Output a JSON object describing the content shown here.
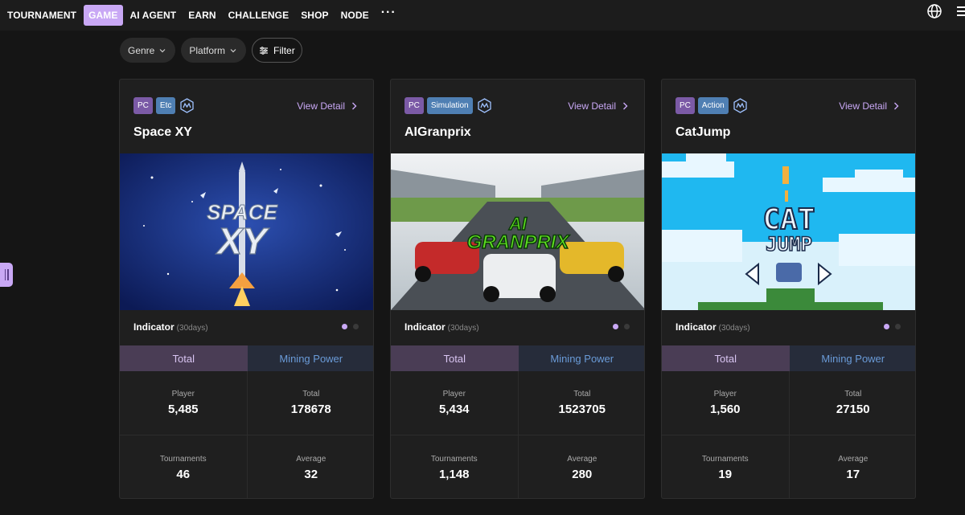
{
  "nav": {
    "items": [
      {
        "label": "TOURNAMENT",
        "active": false
      },
      {
        "label": "GAME",
        "active": true
      },
      {
        "label": "AI AGENT",
        "active": false
      },
      {
        "label": "EARN",
        "active": false
      },
      {
        "label": "CHALLENGE",
        "active": false
      },
      {
        "label": "SHOP",
        "active": false
      },
      {
        "label": "NODE",
        "active": false
      }
    ],
    "more": "···",
    "accent": "#c9a8f5"
  },
  "filters": {
    "genre": "Genre",
    "platform": "Platform",
    "filter": "Filter"
  },
  "cards": [
    {
      "platform": "PC",
      "genre": "Etc",
      "view_detail": "View Detail",
      "title": "Space XY",
      "art_line1": "SPACE",
      "art_line2": "XY",
      "indicator": "Indicator",
      "indicator_period": "(30days)",
      "tab_total": "Total",
      "tab_mining": "Mining Power",
      "stats": [
        {
          "label": "Player",
          "value": "5,485"
        },
        {
          "label": "Total",
          "value": "178678"
        },
        {
          "label": "Tournaments",
          "value": "46"
        },
        {
          "label": "Average",
          "value": "32"
        }
      ]
    },
    {
      "platform": "PC",
      "genre": "Simulation",
      "view_detail": "View Detail",
      "title": "AIGranprix",
      "art_line1": "AI",
      "art_line2": "GRANPRIX",
      "indicator": "Indicator",
      "indicator_period": "(30days)",
      "tab_total": "Total",
      "tab_mining": "Mining Power",
      "stats": [
        {
          "label": "Player",
          "value": "5,434"
        },
        {
          "label": "Total",
          "value": "1523705"
        },
        {
          "label": "Tournaments",
          "value": "1,148"
        },
        {
          "label": "Average",
          "value": "280"
        }
      ]
    },
    {
      "platform": "PC",
      "genre": "Action",
      "view_detail": "View Detail",
      "title": "CatJump",
      "art_line1": "CAT",
      "art_line2": "JUMP",
      "indicator": "Indicator",
      "indicator_period": "(30days)",
      "tab_total": "Total",
      "tab_mining": "Mining Power",
      "stats": [
        {
          "label": "Player",
          "value": "1,560"
        },
        {
          "label": "Total",
          "value": "27150"
        },
        {
          "label": "Tournaments",
          "value": "19"
        },
        {
          "label": "Average",
          "value": "17"
        }
      ]
    }
  ]
}
